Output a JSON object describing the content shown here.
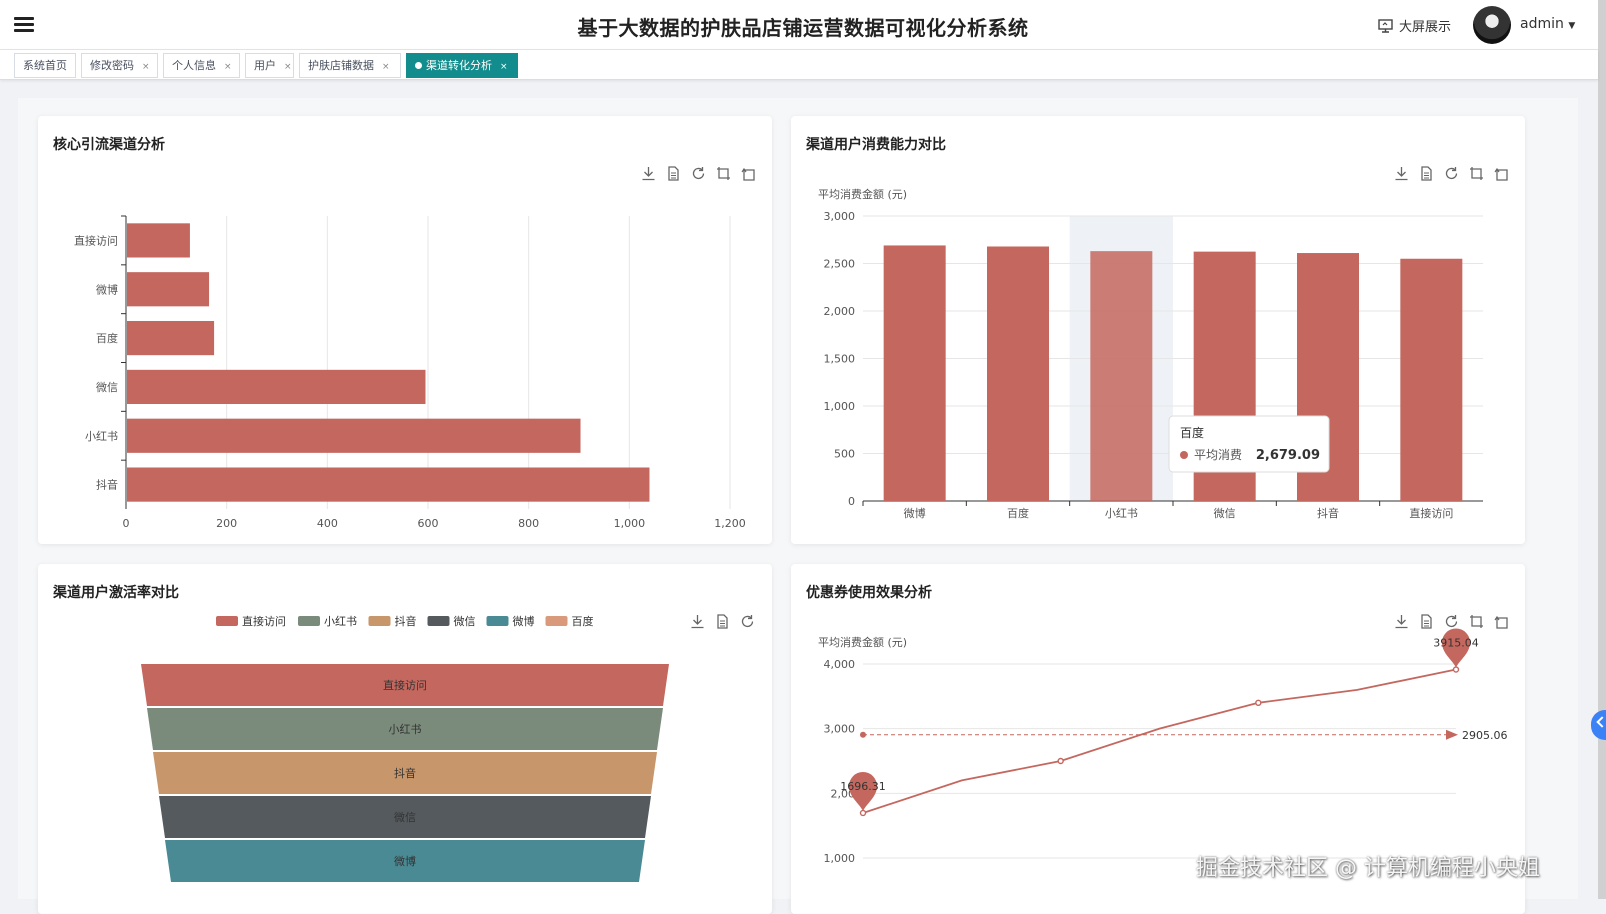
{
  "header": {
    "title": "基于大数据的护肤品店铺运营数据可视化分析系统",
    "bigscreen_label": "大屏展示",
    "user_label": "admin"
  },
  "tabs": [
    {
      "label": "系统首页",
      "closable": false,
      "active": false
    },
    {
      "label": "修改密码",
      "closable": true,
      "active": false
    },
    {
      "label": "个人信息",
      "closable": true,
      "active": false
    },
    {
      "label": "用户",
      "closable": true,
      "active": false
    },
    {
      "label": "护肤店铺数据",
      "closable": true,
      "active": false
    },
    {
      "label": "渠道转化分析",
      "closable": true,
      "active": true
    }
  ],
  "tab_close_glyph": "×",
  "colors": {
    "bar": "#c4675e",
    "accent": "#128c8c",
    "funnel": [
      "#c4675e",
      "#7b8b7b",
      "#c8966b",
      "#555a5e",
      "#4a8a94",
      "#d99a7c"
    ]
  },
  "cards": {
    "c1": {
      "title": "核心引流渠道分析"
    },
    "c2": {
      "title": "渠道用户消费能力对比"
    },
    "c3": {
      "title": "渠道用户激活率对比"
    },
    "c4": {
      "title": "优惠券使用效果分析"
    }
  },
  "chart_data": [
    {
      "type": "bar",
      "orientation": "horizontal",
      "title": "核心引流渠道分析",
      "categories": [
        "直接访问",
        "微博",
        "百度",
        "微信",
        "小红书",
        "抖音"
      ],
      "values": [
        127,
        165,
        175,
        595,
        903,
        1040
      ],
      "xlim": [
        0,
        1200
      ],
      "xticks": [
        0,
        200,
        400,
        600,
        800,
        1000,
        1200
      ],
      "xtick_labels": [
        "0",
        "200",
        "400",
        "600",
        "800",
        "1,000",
        "1,200"
      ],
      "grid": true
    },
    {
      "type": "bar",
      "title": "渠道用户消费能力对比",
      "ylabel": "平均消费金额 (元)",
      "categories": [
        "微博",
        "百度",
        "小红书",
        "微信",
        "抖音",
        "直接访问"
      ],
      "values": [
        2690,
        2679.09,
        2630,
        2625,
        2610,
        2550
      ],
      "ylim": [
        0,
        3000
      ],
      "yticks": [
        0,
        500,
        1000,
        1500,
        2000,
        2500,
        3000
      ],
      "ytick_labels": [
        "0",
        "500",
        "1,000",
        "1,500",
        "2,000",
        "2,500",
        "3,000"
      ],
      "highlight_index": 1,
      "tooltip": {
        "category": "百度",
        "series": "平均消费",
        "value": "2,679.09"
      },
      "grid": true
    },
    {
      "type": "funnel",
      "title": "渠道用户激活率对比",
      "legend": [
        "直接访问",
        "小红书",
        "抖音",
        "微信",
        "微博",
        "百度"
      ],
      "stages": [
        "直接访问",
        "小红书",
        "抖音",
        "微信",
        "微博"
      ],
      "legend_position": "top-center"
    },
    {
      "type": "line",
      "title": "优惠券使用效果分析",
      "ylabel": "平均消费金额 (元)",
      "x_count": 7,
      "values": [
        1696.31,
        2200,
        2500,
        3000,
        3400,
        3600,
        3915.04
      ],
      "ylim": [
        1000,
        4000
      ],
      "yticks": [
        1000,
        2000,
        3000,
        4000
      ],
      "ytick_labels": [
        "1,000",
        "2,00",
        "3,000",
        "4,000"
      ],
      "mark_points": {
        "max_label": "3915.04",
        "min_label": "1696.31"
      },
      "mark_line": {
        "value": 2905.06,
        "label": "2905.06"
      },
      "grid": true
    }
  ],
  "watermark": "掘金技术社区 @ 计算机编程小央姐"
}
